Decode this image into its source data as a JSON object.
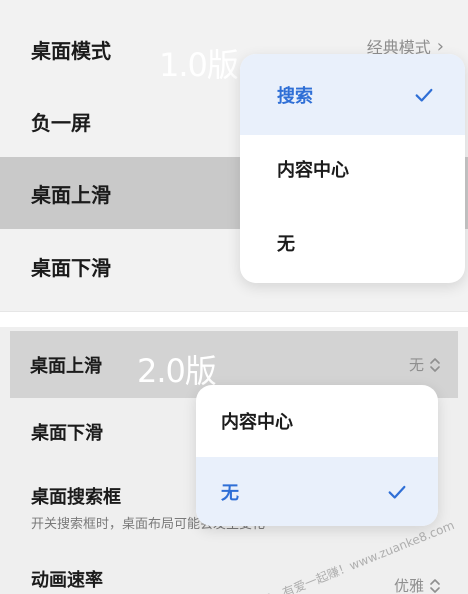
{
  "top_panel": {
    "version_label": "1.0版",
    "rows": [
      {
        "label": "桌面模式",
        "value": "经典模式"
      },
      {
        "label": "负一屏"
      },
      {
        "label": "桌面上滑"
      },
      {
        "label": "桌面下滑"
      }
    ],
    "dropdown": {
      "options": [
        "搜索",
        "内容中心",
        "无"
      ],
      "selected_index": 0
    }
  },
  "bottom_panel": {
    "version_label": "2.0版",
    "rows": [
      {
        "label": "桌面上滑",
        "value": "无"
      },
      {
        "label": "桌面下滑"
      },
      {
        "label": "桌面搜索框",
        "subtitle": "开关搜索框时，桌面布局可能会发生变化"
      },
      {
        "label": "动画速率",
        "value": "优雅"
      }
    ],
    "dropdown": {
      "options": [
        "内容中心",
        "无"
      ],
      "selected_index": 1
    }
  },
  "watermark": "赚客吧，有爱一起赚！www.zuanke8.com",
  "colors": {
    "accent": "#2f6fd6",
    "selected_bg": "#e9f0fb",
    "highlight_row": "#c9c9c9"
  }
}
